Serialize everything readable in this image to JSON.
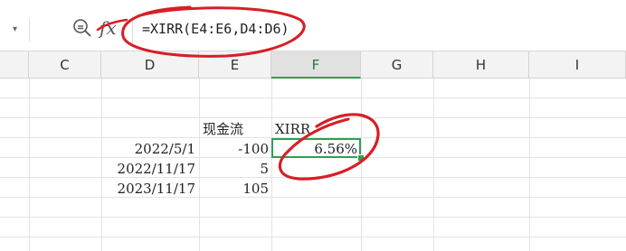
{
  "formula_bar": {
    "formula": "=XIRR(E4:E6,D4:D6)",
    "fx_label": "fx"
  },
  "columns": [
    "C",
    "D",
    "E",
    "F",
    "G",
    "H",
    "I"
  ],
  "active_column": "F",
  "cells": {
    "E3": "现金流",
    "F3": "XIRR",
    "D4": "2022/5/1",
    "E4": "-100",
    "F4": "6.56%",
    "D5": "2022/11/17",
    "E5": "5",
    "D6": "2023/11/17",
    "E6": "105"
  },
  "colors": {
    "selection": "#2e9e55",
    "annotation": "#d61f26",
    "header_bg": "#f3f3f3"
  }
}
